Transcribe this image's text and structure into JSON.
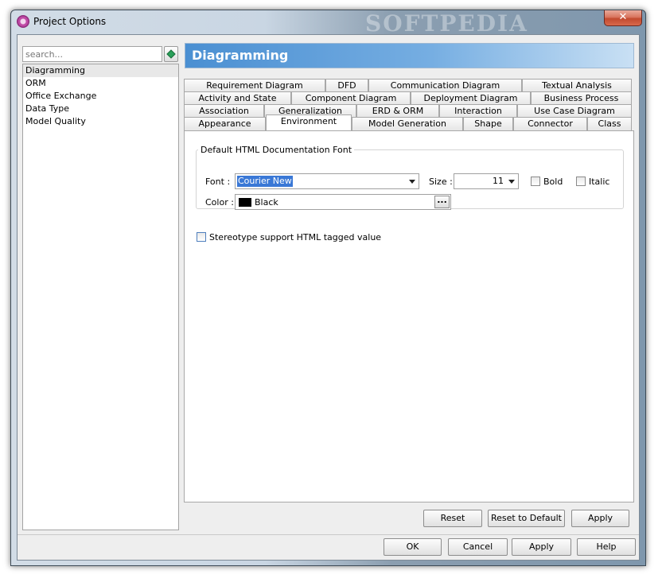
{
  "window": {
    "title": "Project Options",
    "watermark": "SOFTPEDIA",
    "close_glyph": "✕"
  },
  "search": {
    "placeholder": "search..."
  },
  "sidebar": {
    "items": [
      {
        "label": "Diagramming",
        "selected": true
      },
      {
        "label": "ORM"
      },
      {
        "label": "Office Exchange"
      },
      {
        "label": "Data Type"
      },
      {
        "label": "Model Quality"
      }
    ]
  },
  "panel": {
    "title": "Diagramming"
  },
  "tabs": {
    "row1": [
      "Requirement Diagram",
      "DFD",
      "Communication Diagram",
      "Textual Analysis"
    ],
    "row2": [
      "Activity and State",
      "Component Diagram",
      "Deployment Diagram",
      "Business Process"
    ],
    "row3": [
      "Association",
      "Generalization",
      "ERD & ORM",
      "Interaction",
      "Use Case Diagram"
    ],
    "row4": [
      "Appearance",
      "Environment",
      "Model Generation",
      "Shape",
      "Connector",
      "Class"
    ],
    "active": "Environment"
  },
  "font_group": {
    "title": "Default HTML Documentation Font",
    "font_label": "Font :",
    "font_value": "Courier New",
    "size_label": "Size :",
    "size_value": "11",
    "bold_label": "Bold",
    "italic_label": "Italic",
    "color_label": "Color :",
    "color_value": "Black",
    "color_hex": "#000000",
    "ellipsis": "..."
  },
  "stereotype": {
    "label": "Stereotype support HTML tagged value",
    "checked": false
  },
  "panel_buttons": {
    "reset": "Reset",
    "reset_default": "Reset to Default",
    "apply": "Apply"
  },
  "dialog_buttons": {
    "ok": "OK",
    "cancel": "Cancel",
    "apply": "Apply",
    "help": "Help"
  },
  "colors": {
    "header_start": "#4a8fd2",
    "header_end": "#c9e0f4",
    "selection": "#3a78d6"
  }
}
